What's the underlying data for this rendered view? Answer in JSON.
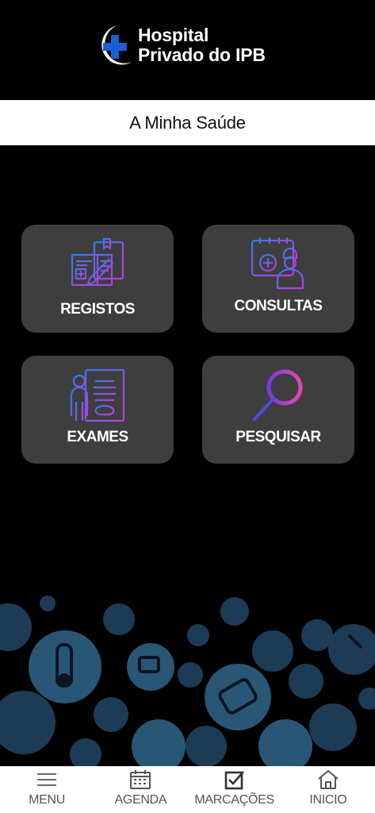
{
  "header": {
    "logo_line1": "Hospital",
    "logo_line2": "Privado do IPB",
    "brand_color": "#1a5fd8"
  },
  "page_title": "A Minha Saúde",
  "tiles": [
    {
      "label": "REGISTOS",
      "icon": "medical-records-icon"
    },
    {
      "label": "CONSULTAS",
      "icon": "doctor-appointment-icon"
    },
    {
      "label": "EXAMES",
      "icon": "xray-icon"
    },
    {
      "label": "PESQUISAR",
      "icon": "magnifier-icon"
    }
  ],
  "bottom_nav": [
    {
      "label": "MENU",
      "icon": "hamburger-icon"
    },
    {
      "label": "AGENDA",
      "icon": "calendar-icon"
    },
    {
      "label": "MARCAÇÕES",
      "icon": "checkbox-icon"
    },
    {
      "label": "INICIO",
      "icon": "home-icon"
    }
  ],
  "colors": {
    "background": "#000000",
    "tile": "#3e3e3e",
    "icon_gradient_start": "#2f7df0",
    "icon_gradient_end": "#c13ad8",
    "bubble": "#1e3b55"
  }
}
